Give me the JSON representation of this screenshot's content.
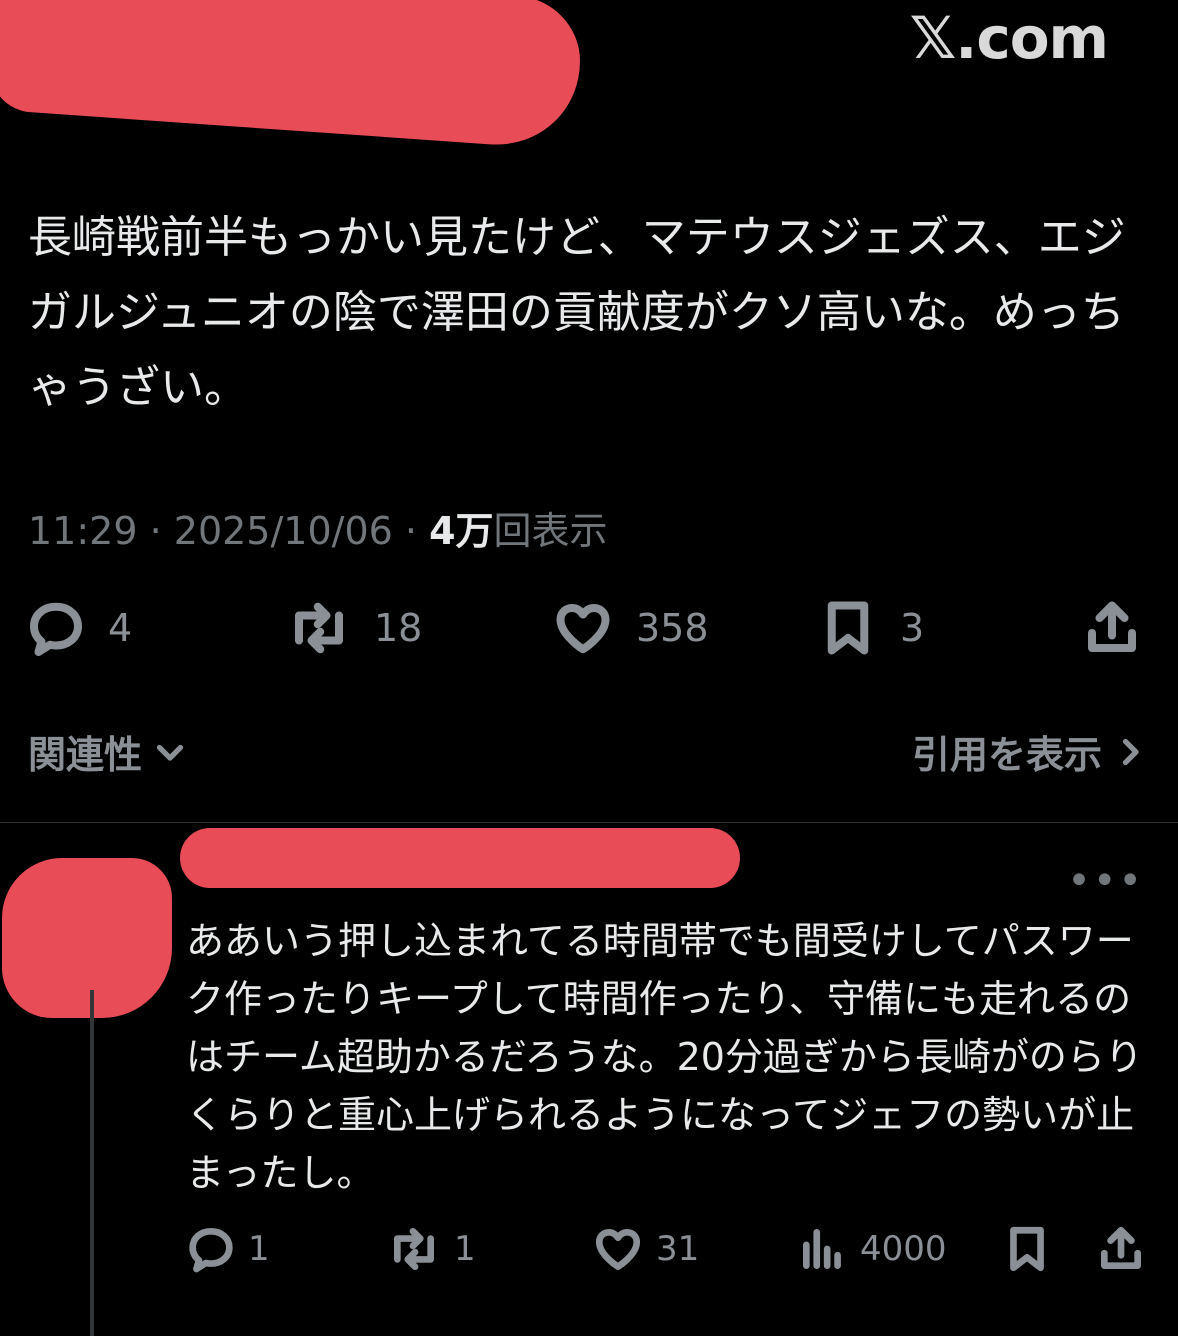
{
  "watermark": "𝕏.com",
  "post": {
    "text": "長崎戦前半もっかい見たけど、マテウスジェズス、エジガルジュニオの陰で澤田の貢献度がクソ高いな。めっちゃうざい。",
    "time": "11:29",
    "date": "2025/10/06",
    "views_count": "4万",
    "views_label": "回表示",
    "actions": {
      "replies": "4",
      "reposts": "18",
      "likes": "358",
      "bookmarks": "3"
    },
    "relevance_label": "関連性",
    "quotes_label": "引用を表示"
  },
  "reply": {
    "text": "ああいう押し込まれてる時間帯でも間受けしてパスワーク作ったりキープして時間作ったり、守備にも走れるのはチーム超助かるだろうな。20分過ぎから長崎がのらりくらりと重心上げられるようになってジェフの勢いが止まったし。",
    "actions": {
      "replies": "1",
      "reposts": "1",
      "likes": "31",
      "views": "4000"
    }
  },
  "colors": {
    "background": "#000000",
    "text": "#e7e9ea",
    "secondary": "#71767b",
    "redaction": "#e84c56"
  },
  "icons": [
    "reply-icon",
    "repost-icon",
    "like-icon",
    "bookmark-icon",
    "share-icon",
    "views-icon",
    "chevron-down-icon",
    "chevron-right-icon",
    "more-icon"
  ]
}
